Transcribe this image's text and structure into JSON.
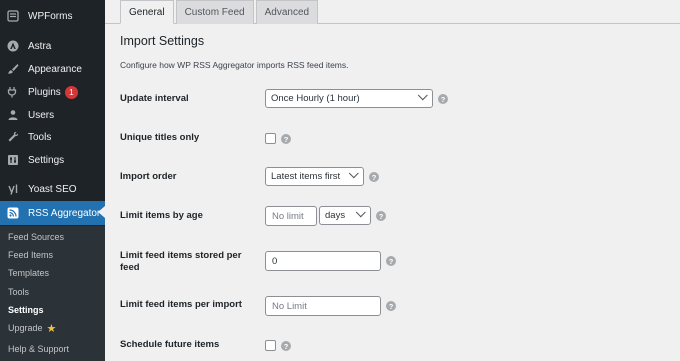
{
  "sidebar": {
    "items": [
      {
        "label": "WPForms",
        "icon": "wpforms-icon"
      },
      {
        "label": "Astra",
        "icon": "astra-icon"
      },
      {
        "label": "Appearance",
        "icon": "paintbrush-icon"
      },
      {
        "label": "Plugins",
        "icon": "plugin-icon",
        "badge": "1"
      },
      {
        "label": "Users",
        "icon": "users-icon"
      },
      {
        "label": "Tools",
        "icon": "wrench-icon"
      },
      {
        "label": "Settings",
        "icon": "settings-icon"
      },
      {
        "label": "Yoast SEO",
        "icon": "yoast-icon"
      },
      {
        "label": "RSS Aggregator",
        "icon": "rss-icon",
        "active": true
      }
    ],
    "submenu": [
      {
        "label": "Feed Sources"
      },
      {
        "label": "Feed Items"
      },
      {
        "label": "Templates"
      },
      {
        "label": "Tools"
      },
      {
        "label": "Settings",
        "current": true
      },
      {
        "label": "Upgrade",
        "star": true
      },
      {
        "label": "Help & Support"
      }
    ]
  },
  "tabs": [
    {
      "label": "General",
      "active": true
    },
    {
      "label": "Custom Feed"
    },
    {
      "label": "Advanced"
    }
  ],
  "section": {
    "title": "Import Settings",
    "description": "Configure how WP RSS Aggregator imports RSS feed items."
  },
  "fields": {
    "update_interval": {
      "label": "Update interval",
      "value": "Once Hourly (1 hour)"
    },
    "unique_titles": {
      "label": "Unique titles only",
      "checked": false
    },
    "import_order": {
      "label": "Import order",
      "value": "Latest items first"
    },
    "limit_age": {
      "label": "Limit items by age",
      "value": "No limit",
      "unit": "days"
    },
    "limit_stored": {
      "label": "Limit feed items stored per feed",
      "value": "0"
    },
    "limit_per_import": {
      "label": "Limit feed items per import",
      "value": "No Limit"
    },
    "schedule_future": {
      "label": "Schedule future items",
      "checked": false
    }
  },
  "colors": {
    "sidebar_bg": "#1d2327",
    "active_bg": "#2271b1",
    "badge": "#d63638",
    "star": "#f0c33c"
  }
}
